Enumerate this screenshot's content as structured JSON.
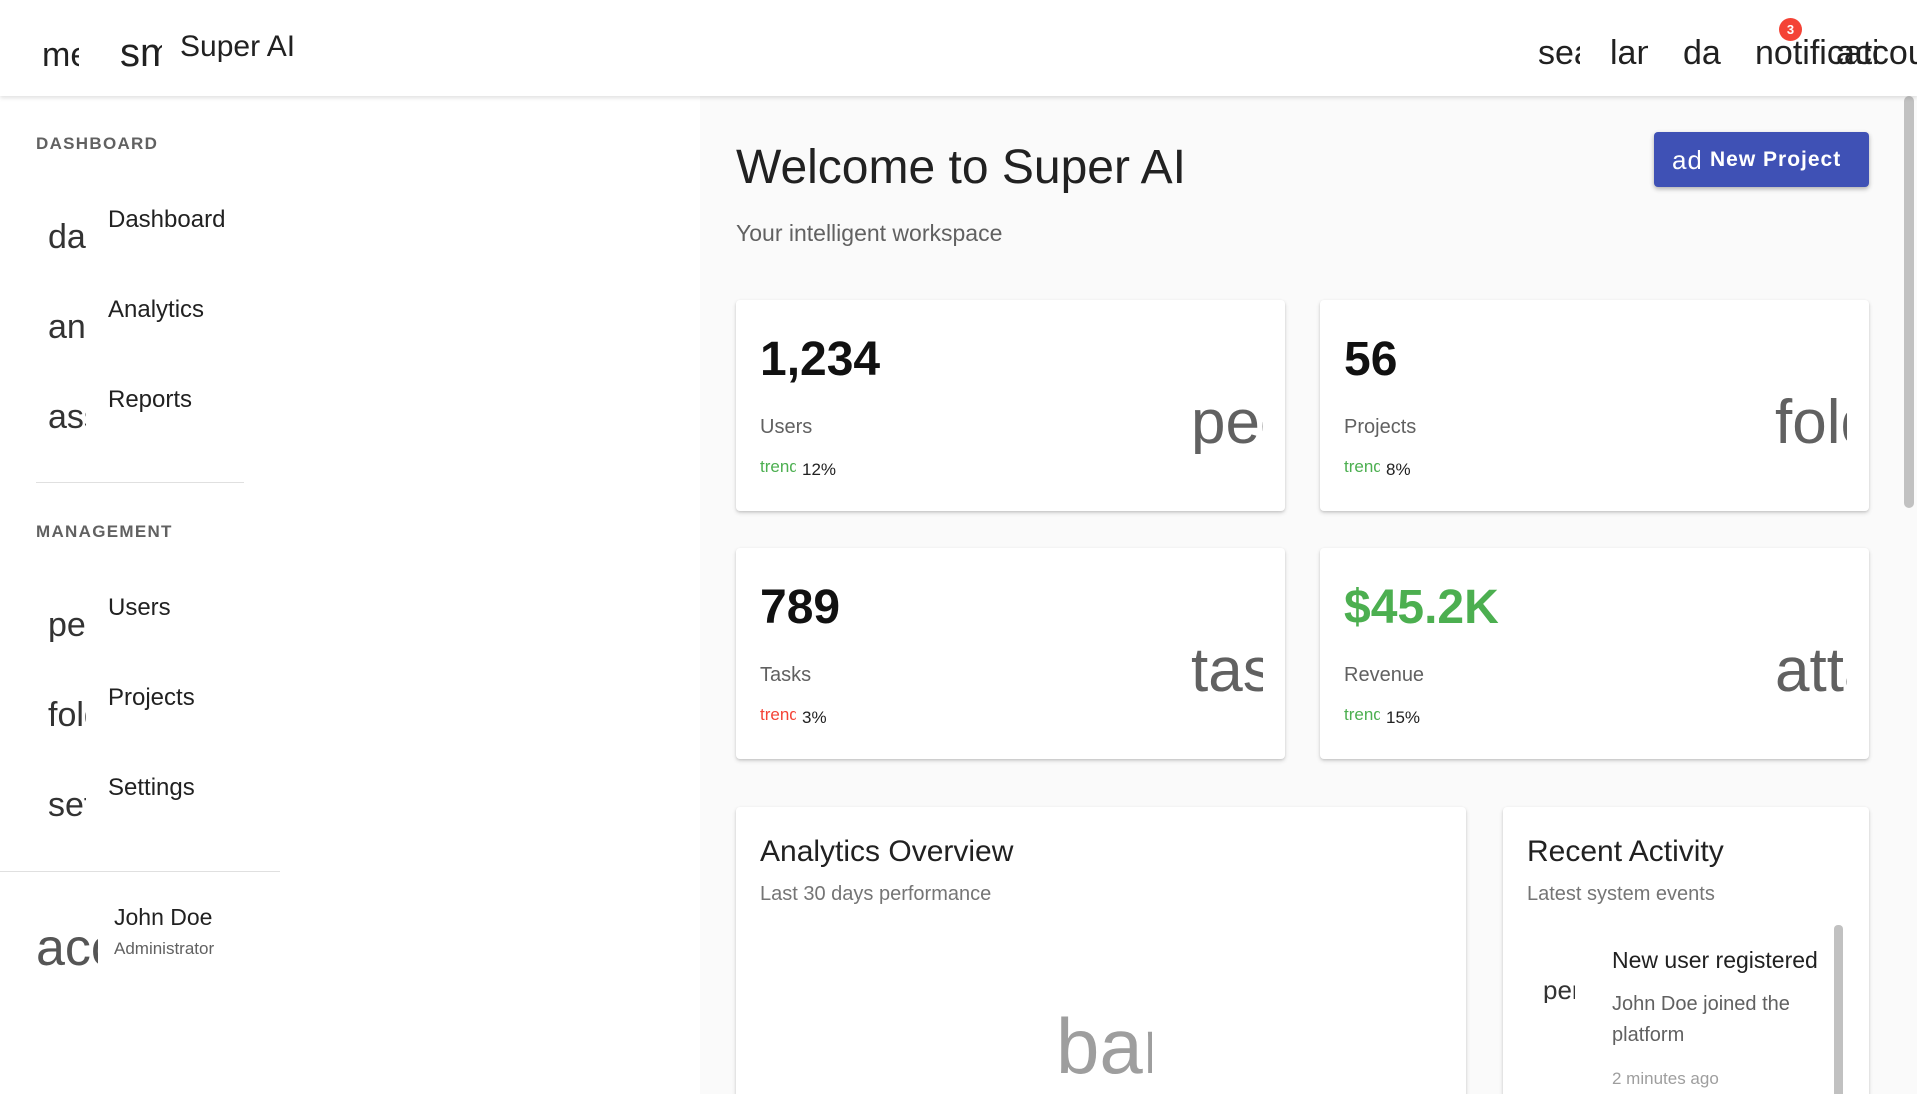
{
  "topbar": {
    "menu_glyph": "menu",
    "smart_glyph": "smart_toy",
    "title": "Super AI",
    "search_glyph": "search",
    "language_glyph": "language",
    "darkmode_glyph": "dark_mode",
    "notifications_glyph": "notifications",
    "notifications_badge": "3",
    "account_glyph": "account_circle"
  },
  "sidebar": {
    "section_dashboard": "DASHBOARD",
    "section_management": "MANAGEMENT",
    "items": [
      {
        "glyph": "dashboard",
        "label": "Dashboard"
      },
      {
        "glyph": "analytics",
        "label": "Analytics"
      },
      {
        "glyph": "assessment",
        "label": "Reports"
      },
      {
        "glyph": "people",
        "label": "Users"
      },
      {
        "glyph": "folder",
        "label": "Projects"
      },
      {
        "glyph": "settings",
        "label": "Settings"
      }
    ],
    "user": {
      "glyph": "account_circle",
      "name": "John Doe",
      "role": "Administrator"
    }
  },
  "main": {
    "title": "Welcome to Super AI",
    "subtitle": "Your intelligent workspace",
    "new_project": {
      "glyph": "add",
      "label": "New Project"
    },
    "stats": [
      {
        "value": "1,234",
        "label": "Users",
        "trend_glyph": "trending_up",
        "trend": "12%",
        "icon_glyph": "people",
        "trend_color": "#4caf50",
        "value_color": "#111111"
      },
      {
        "value": "56",
        "label": "Projects",
        "trend_glyph": "trending_up",
        "trend": "8%",
        "icon_glyph": "folder",
        "trend_color": "#4caf50",
        "value_color": "#111111"
      },
      {
        "value": "789",
        "label": "Tasks",
        "trend_glyph": "trending_down",
        "trend": "3%",
        "icon_glyph": "task",
        "trend_color": "#f44336",
        "value_color": "#111111"
      },
      {
        "value": "$45.2K",
        "label": "Revenue",
        "trend_glyph": "trending_up",
        "trend": "15%",
        "icon_glyph": "attach_money",
        "trend_color": "#4caf50",
        "value_color": "#4caf50"
      }
    ],
    "analytics": {
      "title": "Analytics Overview",
      "subtitle": "Last 30 days performance",
      "placeholder_glyph": "bar_chart"
    },
    "activity": {
      "title": "Recent Activity",
      "subtitle": "Latest system events",
      "items": [
        {
          "glyph": "person_add",
          "title": "New user registered",
          "description": "John Doe joined the platform",
          "time": "2 minutes ago"
        }
      ]
    }
  },
  "colors": {
    "primary": "#3f51b5",
    "success": "#4caf50",
    "danger": "#f44336",
    "badge": "#f44336"
  }
}
